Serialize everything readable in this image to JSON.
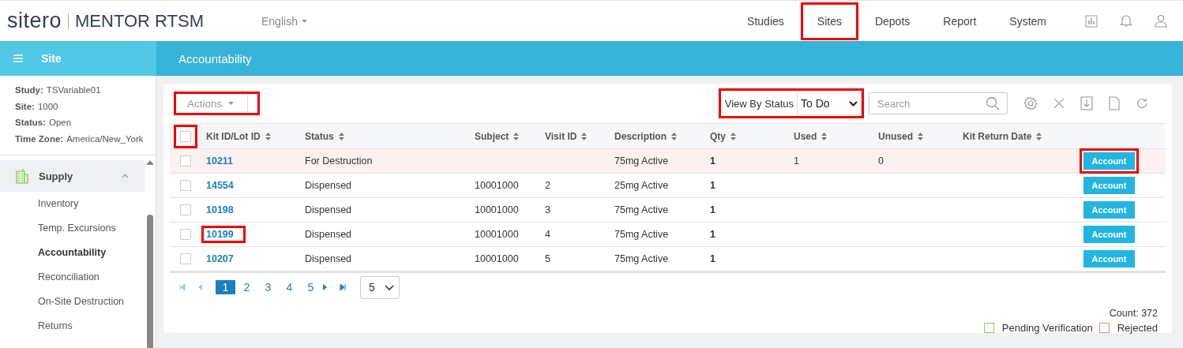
{
  "brand": {
    "logo": "sitero",
    "product": "MENTOR RTSM"
  },
  "language": "English",
  "nav": [
    {
      "label": "Studies",
      "highlighted": false
    },
    {
      "label": "Sites",
      "highlighted": true
    },
    {
      "label": "Depots",
      "highlighted": false
    },
    {
      "label": "Report",
      "highlighted": false
    },
    {
      "label": "System",
      "highlighted": false
    }
  ],
  "sidebar": {
    "title": "Site",
    "info": [
      {
        "label": "Study:",
        "value": "TSVariable01"
      },
      {
        "label": "Site:",
        "value": "1000"
      },
      {
        "label": "Status:",
        "value": "Open"
      },
      {
        "label": "Time Zone:",
        "value": "America/New_York"
      }
    ],
    "section": {
      "label": "Supply",
      "expanded": true
    },
    "items": [
      {
        "label": "Inventory",
        "selected": false
      },
      {
        "label": "Temp. Excursions",
        "selected": false
      },
      {
        "label": "Accountability",
        "selected": true
      },
      {
        "label": "Reconciliation",
        "selected": false
      },
      {
        "label": "On-Site Destruction",
        "selected": false
      },
      {
        "label": "Returns",
        "selected": false
      }
    ]
  },
  "page_title": "Accountability",
  "toolbar": {
    "actions": {
      "label": "Actions",
      "highlighted": true
    },
    "view_by_status": {
      "label": "View By Status",
      "value": "To Do",
      "highlighted": true
    },
    "search": {
      "placeholder": "Search"
    }
  },
  "table": {
    "header_checkbox": {
      "checked": false,
      "highlighted": true
    },
    "columns": [
      "Kit ID/Lot ID",
      "Status",
      "Subject",
      "Visit ID",
      "Description",
      "Qty",
      "Used",
      "Unused",
      "Kit Return Date"
    ],
    "rows": [
      {
        "kit_id": "10211",
        "status": "For Destruction",
        "subject": "",
        "visit_id": "",
        "description": "75mg Active",
        "qty": "1",
        "used": "1",
        "unused": "0",
        "kit_return_date": "",
        "button": "Account",
        "checked": false,
        "rejected": true,
        "id_highlighted": false,
        "button_highlighted": true
      },
      {
        "kit_id": "14554",
        "status": "Dispensed",
        "subject": "10001000",
        "visit_id": "2",
        "description": "25mg Active",
        "qty": "1",
        "used": "",
        "unused": "",
        "kit_return_date": "",
        "button": "Account",
        "checked": false,
        "rejected": false,
        "id_highlighted": false,
        "button_highlighted": false
      },
      {
        "kit_id": "10198",
        "status": "Dispensed",
        "subject": "10001000",
        "visit_id": "3",
        "description": "75mg Active",
        "qty": "1",
        "used": "",
        "unused": "",
        "kit_return_date": "",
        "button": "Account",
        "checked": false,
        "rejected": false,
        "id_highlighted": false,
        "button_highlighted": false
      },
      {
        "kit_id": "10199",
        "status": "Dispensed",
        "subject": "10001000",
        "visit_id": "4",
        "description": "75mg Active",
        "qty": "1",
        "used": "",
        "unused": "",
        "kit_return_date": "",
        "button": "Account",
        "checked": false,
        "rejected": false,
        "id_highlighted": true,
        "button_highlighted": false
      },
      {
        "kit_id": "10207",
        "status": "Dispensed",
        "subject": "10001000",
        "visit_id": "5",
        "description": "75mg Active",
        "qty": "1",
        "used": "",
        "unused": "",
        "kit_return_date": "",
        "button": "Account",
        "checked": false,
        "rejected": false,
        "id_highlighted": false,
        "button_highlighted": false
      }
    ]
  },
  "pagination": {
    "pages": [
      {
        "label": "1",
        "selected": true
      },
      {
        "label": "2",
        "selected": false
      },
      {
        "label": "3",
        "selected": false
      },
      {
        "label": "4",
        "selected": false
      },
      {
        "label": "5",
        "selected": false
      }
    ],
    "page_size": "5"
  },
  "count": "Count: 372",
  "legend": [
    {
      "label": "Pending Verification",
      "color": "#8ccf4d"
    },
    {
      "label": "Rejected",
      "color": "#e89090"
    }
  ]
}
